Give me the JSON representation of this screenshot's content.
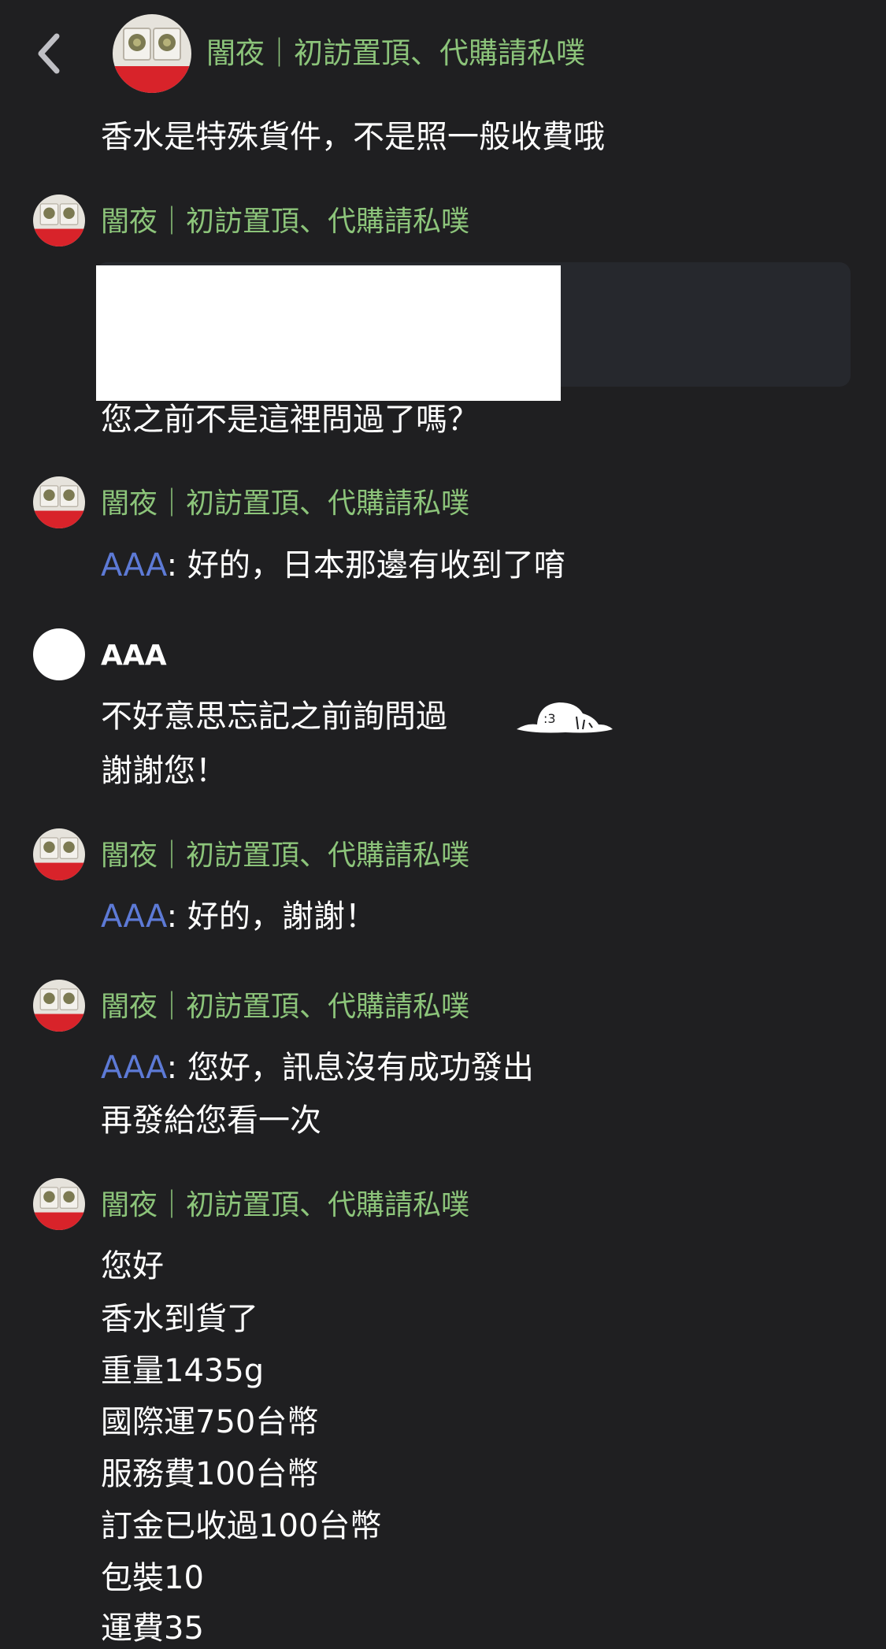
{
  "header": {
    "back_icon": "chevron-left-icon",
    "title": "闇夜｜初訪置頂、代購請私噗",
    "subtitle": "香水是特殊貨件，不是照一般收費哦"
  },
  "colors": {
    "background": "#1f1f21",
    "sender_name": "#8cc47a",
    "mention": "#5d7ad6",
    "text": "#ffffff"
  },
  "messages": [
    {
      "sender": "闇夜｜初訪置頂、代購請私噗",
      "lines": [
        "您之前不是這裡問過了嗎？"
      ]
    },
    {
      "sender": "闇夜｜初訪置頂、代購請私噗",
      "mention": "AAA",
      "lines": [
        ": 好的，日本那邊有收到了唷"
      ]
    },
    {
      "sender": "AAA",
      "lines": [
        "不好意思忘記之前詢問過",
        "謝謝您！"
      ],
      "sticker": "sleeping-blob-sticker"
    },
    {
      "sender": "闇夜｜初訪置頂、代購請私噗",
      "mention": "AAA",
      "lines": [
        ": 好的，謝謝！"
      ]
    },
    {
      "sender": "闇夜｜初訪置頂、代購請私噗",
      "mention": "AAA",
      "lines": [
        ": 您好，訊息沒有成功發出",
        "再發給您看一次"
      ]
    },
    {
      "sender": "闇夜｜初訪置頂、代購請私噗",
      "lines": [
        "您好",
        "香水到貨了",
        "重量1435g",
        "國際運750台幣",
        "服務費100台幣",
        "訂金已收過100台幣",
        "包裝10",
        "運費35"
      ]
    }
  ]
}
